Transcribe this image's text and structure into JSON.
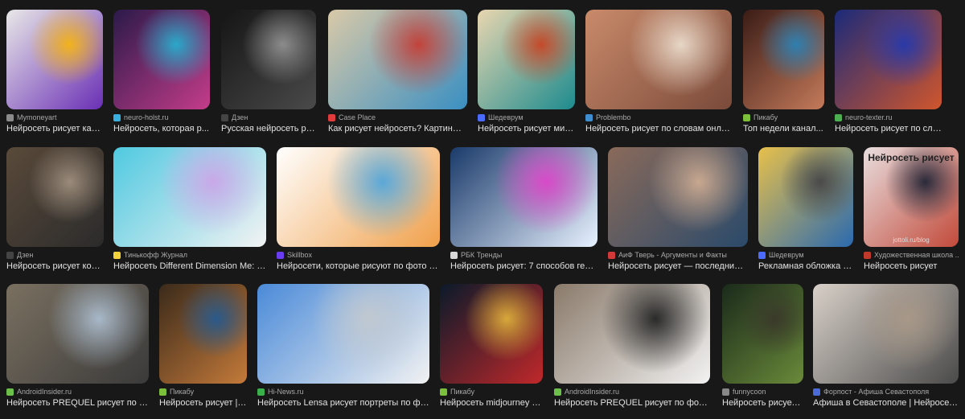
{
  "results": [
    {
      "source": "Mymoneyart",
      "caption": "Нейросеть рисует кар...",
      "favicon_color": "#8b8b8b",
      "colors": [
        "#e8e8e8",
        "#6a2fb5",
        "#f2b21c"
      ]
    },
    {
      "source": "neuro-holst.ru",
      "caption": "Нейросеть, которая р...",
      "favicon_color": "#3ab0e0",
      "colors": [
        "#2b1a4a",
        "#c43c8a",
        "#2aa8c9"
      ]
    },
    {
      "source": "Дзен",
      "caption": "Русская нейросеть ри...",
      "favicon_color": "#444444",
      "colors": [
        "#151515",
        "#4a4a4a",
        "#8c8c8c"
      ]
    },
    {
      "source": "Case Place",
      "caption": "Как рисует нейросеть? Картины, с...",
      "favicon_color": "#e23b3b",
      "colors": [
        "#d9c9a8",
        "#3a8fc2",
        "#c2433b"
      ]
    },
    {
      "source": "Шедеврум",
      "caption": "Нейросеть рисует мир...",
      "favicon_color": "#4b6bff",
      "colors": [
        "#e8d6b0",
        "#1d8b8e",
        "#c44a2a"
      ]
    },
    {
      "source": "Problembo",
      "caption": "Нейросеть рисует по словам онлай...",
      "favicon_color": "#3f8fd0",
      "colors": [
        "#c98a6a",
        "#7a4a3a",
        "#e7d6c6"
      ]
    },
    {
      "source": "Пикабу",
      "caption": "Топ недели канал...",
      "favicon_color": "#7cbf3a",
      "colors": [
        "#3a1c16",
        "#c47a5a",
        "#2f7fb0"
      ]
    },
    {
      "source": "neuro-texter.ru",
      "caption": "Нейросеть рисует по словам ...",
      "favicon_color": "#4caf50",
      "colors": [
        "#1b2a7a",
        "#d0562c",
        "#2a3aa8"
      ]
    },
    {
      "source": "Дзен",
      "caption": "Нейросеть рисует кош...",
      "favicon_color": "#444444",
      "colors": [
        "#5a4a3a",
        "#2b2b2b",
        "#9a8a7a"
      ]
    },
    {
      "source": "Тинькофф Журнал",
      "caption": "Нейросеть Different Dimension Me: ка...",
      "favicon_color": "#f2d13a",
      "colors": [
        "#4fc9e0",
        "#f3f3f3",
        "#c9a8e8"
      ]
    },
    {
      "source": "Skillbox",
      "caption": "Нейросети, которые рисуют по фото и с...",
      "favicon_color": "#6a3df0",
      "colors": [
        "#ffffff",
        "#f0a04a",
        "#5aa8d8"
      ]
    },
    {
      "source": "РБК Тренды",
      "caption": "Нейросеть рисует: 7 способов гене...",
      "favicon_color": "#d8d8d8",
      "colors": [
        "#1a3a6a",
        "#e8f2ff",
        "#d84ac8"
      ]
    },
    {
      "source": "АиФ Тверь - Аргументы и Факты",
      "caption": "Нейросеть рисует — последние н...",
      "favicon_color": "#d23a3a",
      "colors": [
        "#8a6a5a",
        "#2a4a6a",
        "#c8a890"
      ]
    },
    {
      "source": "Шедеврум",
      "caption": "Рекламная обложка \"...",
      "favicon_color": "#4b6bff",
      "colors": [
        "#e8c04a",
        "#2a6ab0",
        "#4a4a4a"
      ]
    },
    {
      "source": "Художественная школа ...",
      "caption": "Нейросеть рисует",
      "favicon_color": "#c0392b",
      "colors": [
        "#e8dede",
        "#c24a3a",
        "#2a2a3a"
      ],
      "overlay": "Нейросеть рисует",
      "sub": "jottoli.ru/blog"
    },
    {
      "source": "AndroidInsider.ru",
      "caption": "Нейросеть PREQUEL рисует по ф...",
      "favicon_color": "#6cc04a",
      "colors": [
        "#7a7060",
        "#3a3a3a",
        "#a8b8c8"
      ]
    },
    {
      "source": "Пикабу",
      "caption": "Нейросеть рисует | ...",
      "favicon_color": "#7cbf3a",
      "colors": [
        "#3a2a1a",
        "#c47a3a",
        "#2a5a8a"
      ]
    },
    {
      "source": "Hi-News.ru",
      "caption": "Нейросеть Lensa рисует портреты по фото...",
      "favicon_color": "#3ab04a",
      "colors": [
        "#4a8ad8",
        "#f2f2f2",
        "#c0c8d0"
      ]
    },
    {
      "source": "Пикабу",
      "caption": "Нейросеть midjourney р...",
      "favicon_color": "#7cbf3a",
      "colors": [
        "#0a1a2a",
        "#c0282a",
        "#d8a83a"
      ]
    },
    {
      "source": "AndroidInsider.ru",
      "caption": "Нейросеть PREQUEL рисует по фото...",
      "favicon_color": "#6cc04a",
      "colors": [
        "#8a7a6a",
        "#f2f2f2",
        "#2a2a2a"
      ]
    },
    {
      "source": "funnycoon",
      "caption": "Нейросеть рисует ...",
      "favicon_color": "#888888",
      "colors": [
        "#1a2a1a",
        "#6a8a3a",
        "#3a3a2a"
      ]
    },
    {
      "source": "Форпост - Афиша Севастополя",
      "caption": "Афиша в Севастополе | Нейросети-...",
      "favicon_color": "#4a6ad8",
      "colors": [
        "#d8d0c8",
        "#4a4a4a",
        "#a89888"
      ]
    }
  ]
}
